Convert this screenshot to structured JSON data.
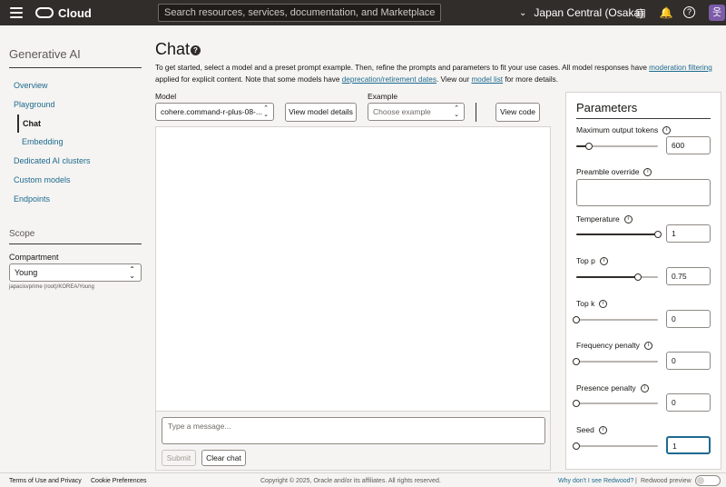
{
  "topbar": {
    "brand": "Cloud",
    "search_placeholder": "Search resources, services, documentation, and Marketplace",
    "region": "Japan Central (Osaka)",
    "avatar_initial": "웃"
  },
  "sidebar": {
    "title": "Generative AI",
    "items": [
      {
        "label": "Overview"
      },
      {
        "label": "Playground"
      },
      {
        "label": "Chat"
      },
      {
        "label": "Embedding"
      },
      {
        "label": "Dedicated AI clusters"
      },
      {
        "label": "Custom models"
      },
      {
        "label": "Endpoints"
      }
    ],
    "scope_title": "Scope",
    "compartment_label": "Compartment",
    "compartment_value": "Young",
    "compartment_path": "japacisvprime (root)/KOREA/Young"
  },
  "main": {
    "title": "Chat",
    "intro_1": "To get started, select a model and a preset prompt example. Then, refine the prompts and parameters to fit your use cases. All model responses have ",
    "intro_link1": "moderation filtering",
    "intro_2": " applied for explicit content. Note that some models have ",
    "intro_link2": "deprecation/retirement dates",
    "intro_3": ". View our ",
    "intro_link3": "model list",
    "intro_4": " for more details.",
    "model_label": "Model",
    "model_value": "cohere.command-r-plus-08-...",
    "view_model_details": "View model details",
    "example_label": "Example",
    "example_placeholder": "Choose example",
    "view_code": "View code",
    "message_placeholder": "Type a message...",
    "submit": "Submit",
    "clear_chat": "Clear chat"
  },
  "parameters": {
    "title": "Parameters",
    "max_tokens": {
      "label": "Maximum output tokens",
      "value": "600",
      "level": 0.15
    },
    "preamble": {
      "label": "Preamble override"
    },
    "temperature": {
      "label": "Temperature",
      "value": "1",
      "level": 1.0
    },
    "top_p": {
      "label": "Top p",
      "value": "0.75",
      "level": 0.75
    },
    "top_k": {
      "label": "Top k",
      "value": "0",
      "level": 0.0
    },
    "frequency_penalty": {
      "label": "Frequency penalty",
      "value": "0",
      "level": 0.0
    },
    "presence_penalty": {
      "label": "Presence penalty",
      "value": "0",
      "level": 0.0
    },
    "seed": {
      "label": "Seed",
      "value": "1",
      "level": 0.0
    }
  },
  "footer": {
    "terms": "Terms of Use and Privacy",
    "cookies": "Cookie Preferences",
    "copyright": "Copyright © 2025, Oracle and/or its affiliates. All rights reserved.",
    "redwood_why": "Why don't I see Redwood?",
    "separator": "|",
    "redwood_preview": "Redwood preview"
  }
}
